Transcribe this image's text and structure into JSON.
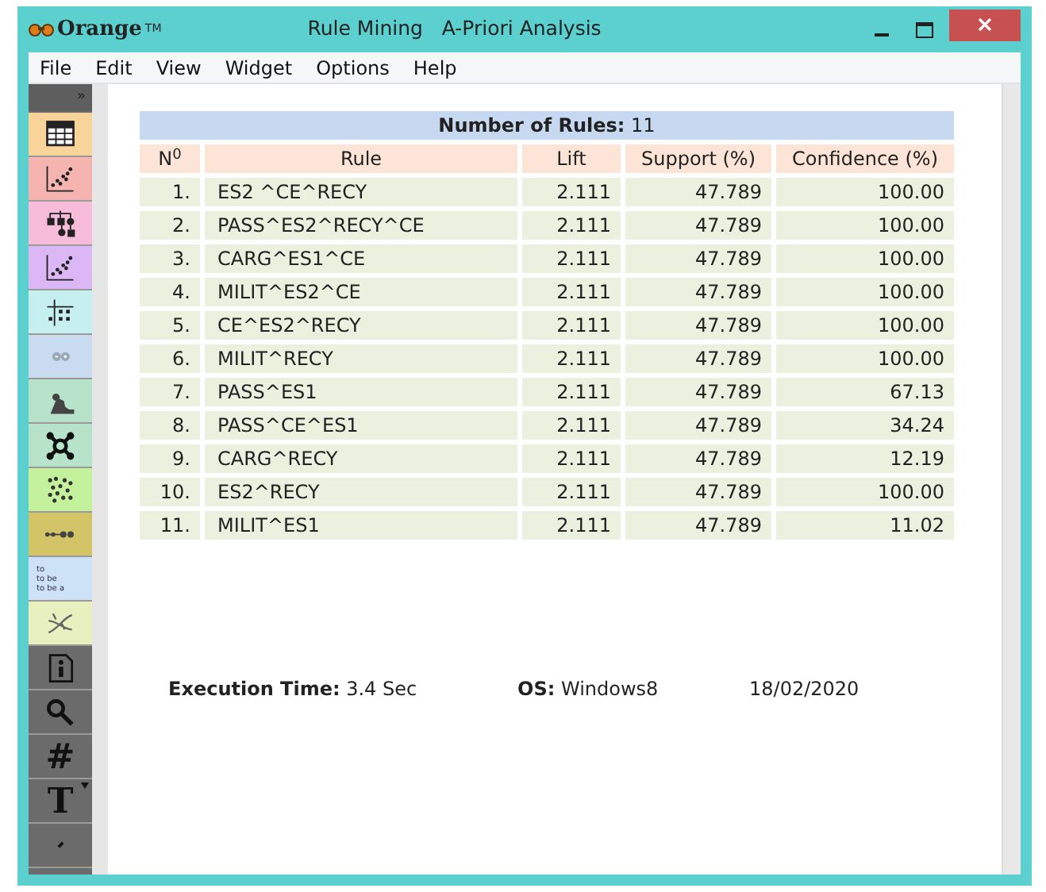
{
  "app": {
    "logo": "Orange",
    "trademark": "TM"
  },
  "window": {
    "title": "Rule Mining   A-Priori Analysis"
  },
  "menu": [
    "File",
    "Edit",
    "View",
    "Widget",
    "Options",
    "Help"
  ],
  "toolbox": {
    "collapse": "»",
    "items": [
      {
        "kind": "table",
        "color": "#f9d49a"
      },
      {
        "kind": "scatter",
        "color": "#f6b4b0"
      },
      {
        "kind": "tree",
        "color": "#f7bcd9"
      },
      {
        "kind": "scatter",
        "color": "#dcb7f5"
      },
      {
        "kind": "grid",
        "color": "#c6f0f0"
      },
      {
        "kind": "blur",
        "color": "#c9dbee"
      },
      {
        "kind": "digger",
        "color": "#b6e3c9"
      },
      {
        "kind": "network",
        "color": "#b6e3c9"
      },
      {
        "kind": "cluster",
        "color": "#c4f29c"
      },
      {
        "kind": "sequence",
        "color": "#d3c567"
      },
      {
        "kind": "words",
        "color": "#cde1f7",
        "lines": [
          "to",
          "to be",
          "to be a"
        ]
      },
      {
        "kind": "dna",
        "color": "#e8f0c0"
      },
      {
        "kind": "info",
        "color": "#6b6b6b"
      },
      {
        "kind": "search",
        "color": "#6b6b6b"
      },
      {
        "kind": "glyph",
        "color": "#6b6b6b",
        "glyph": "#"
      },
      {
        "kind": "glyph",
        "color": "#6b6b6b",
        "glyph": "T",
        "menu": true
      },
      {
        "kind": "cut",
        "color": "#6b6b6b"
      }
    ]
  },
  "table": {
    "caption": "**Number of Rules:** 11",
    "columns": [
      "N$^{0}$",
      "Rule",
      "Lift",
      "Support (%)",
      "Confidence (%)"
    ],
    "rows": [
      [
        "1.",
        "ES2 ^CE^RECY",
        "2.111",
        "47.789",
        "100.00"
      ],
      [
        "2.",
        "PASS^ES2^RECY^CE",
        "2.111",
        "47.789",
        "100.00"
      ],
      [
        "3.",
        "CARG^ES1^CE",
        "2.111",
        "47.789",
        "100.00"
      ],
      [
        "4.",
        "MILIT^ES2^CE",
        "2.111",
        "47.789",
        "100.00"
      ],
      [
        "5.",
        "CE^ES2^RECY",
        "2.111",
        "47.789",
        "100.00"
      ],
      [
        "6.",
        "MILIT^RECY",
        "2.111",
        "47.789",
        "100.00"
      ],
      [
        "7.",
        "PASS^ES1",
        "2.111",
        "47.789",
        "67.13"
      ],
      [
        "8.",
        "PASS^CE^ES1",
        "2.111",
        "47.789",
        "34.24"
      ],
      [
        "9.",
        "CARG^RECY",
        "2.111",
        "47.789",
        "12.19"
      ],
      [
        "10.",
        "ES2^RECY",
        "2.111",
        "47.789",
        "100.00"
      ],
      [
        "11.",
        "MILIT^ES1",
        "2.111",
        "47.789",
        "11.02"
      ]
    ]
  },
  "footer": {
    "execution": "**Execution Time:** 3.4 Sec",
    "os": "**OS:** Windows8",
    "date": "18/02/2020"
  }
}
